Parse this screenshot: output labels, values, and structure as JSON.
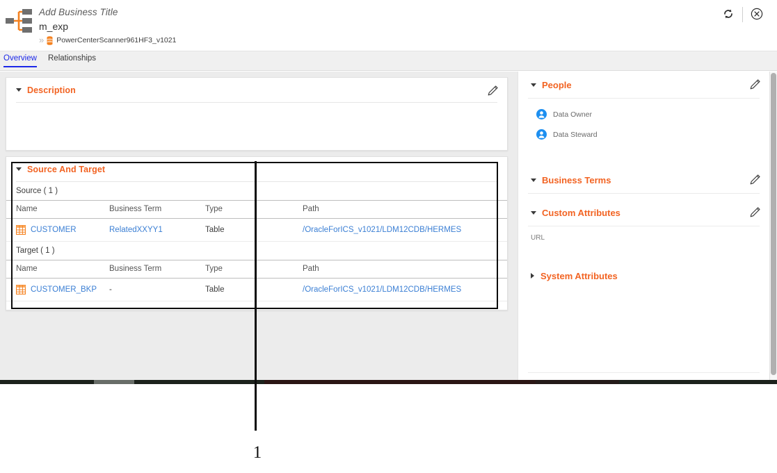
{
  "header": {
    "asset_icon": "mapping-icon",
    "business_title_placeholder": "Add Business Title",
    "asset_name": "m_exp",
    "breadcrumb": {
      "chevron": "»",
      "resource_icon": "database-icon",
      "resource_name": "PowerCenterScanner961HF3_v1021"
    },
    "actions": {
      "refresh_label": "refresh-icon",
      "close_label": "close-icon"
    }
  },
  "tabs": [
    {
      "label": "Overview",
      "active": true
    },
    {
      "label": "Relationships",
      "active": false
    }
  ],
  "description": {
    "title": "Description",
    "edit_label": "edit-icon",
    "body": ""
  },
  "source_and_target": {
    "title": "Source And Target",
    "columns": [
      "Name",
      "Business Term",
      "Type",
      "Path"
    ],
    "source": {
      "label": "Source ( 1 )",
      "rows": [
        {
          "name": "CUSTOMER",
          "business_term": "RelatedXXYY1",
          "type": "Table",
          "path": "/OracleForICS_v1021/LDM12CDB/HERMES"
        }
      ]
    },
    "target": {
      "label": "Target ( 1 )",
      "rows": [
        {
          "name": "CUSTOMER_BKP",
          "business_term": "-",
          "type": "Table",
          "path": "/OracleForICS_v1021/LDM12CDB/HERMES"
        }
      ]
    }
  },
  "right_panel": {
    "people": {
      "title": "People",
      "edit_label": "edit-icon",
      "roles": [
        {
          "label": "Data Owner"
        },
        {
          "label": "Data Steward"
        }
      ]
    },
    "business_terms": {
      "title": "Business Terms",
      "edit_label": "edit-icon"
    },
    "custom_attributes": {
      "title": "Custom Attributes",
      "edit_label": "edit-icon",
      "attributes": [
        {
          "label": "URL",
          "value": ""
        }
      ]
    },
    "system_attributes": {
      "title": "System Attributes",
      "collapsed": true
    }
  },
  "annotation": {
    "callout_number": "1"
  },
  "colors": {
    "accent_orange": "#f26322",
    "link_blue": "#3b7fd4",
    "tab_active_blue": "#1b27e8",
    "avatar_blue": "#1d8ff0",
    "panel_bg": "#ececec",
    "highlight_border": "#0b0b0b"
  }
}
